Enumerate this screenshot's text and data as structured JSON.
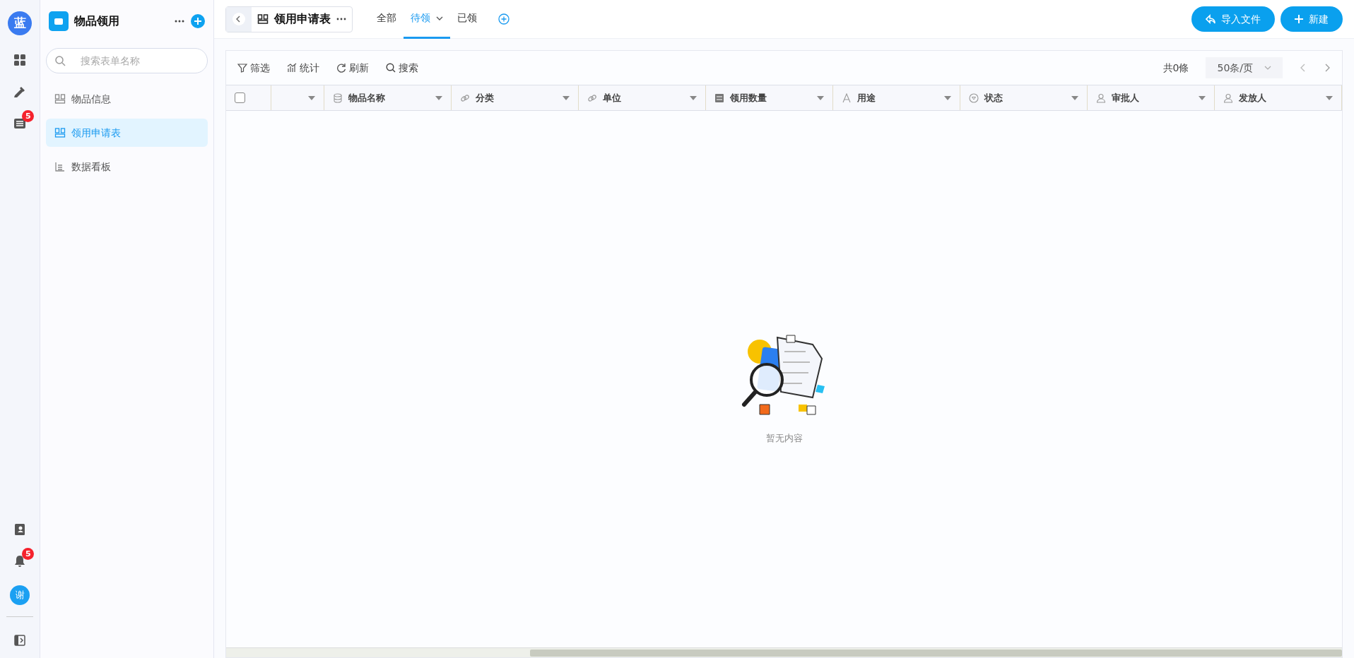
{
  "rail": {
    "logo": "蓝",
    "items": [
      {
        "kind": "apps"
      },
      {
        "kind": "tools"
      },
      {
        "kind": "table",
        "badge": "5"
      }
    ],
    "bottom_items": [
      {
        "kind": "contacts"
      },
      {
        "kind": "bell",
        "badge": "5"
      }
    ],
    "avatar": "谢"
  },
  "sidebar": {
    "app_title": "物品领用",
    "search": {
      "placeholder": "搜索表单名称"
    },
    "items": [
      {
        "label": "物品信息",
        "kind": "form",
        "selected": false
      },
      {
        "label": "领用申请表",
        "kind": "form",
        "selected": true
      },
      {
        "label": "数据看板",
        "kind": "dashboard",
        "selected": false
      }
    ]
  },
  "header": {
    "form_title": "领用申请表",
    "tabs": [
      {
        "label": "全部",
        "selected": false,
        "dropdown": false
      },
      {
        "label": "待领",
        "selected": true,
        "dropdown": true
      },
      {
        "label": "已领",
        "selected": false,
        "dropdown": false
      }
    ],
    "buttons": [
      {
        "label": "导入文件",
        "kind": "import"
      },
      {
        "label": "新建",
        "kind": "add"
      }
    ]
  },
  "toolbar": {
    "actions": [
      {
        "label": "筛选",
        "kind": "filter"
      },
      {
        "label": "统计",
        "kind": "chart"
      },
      {
        "label": "刷新",
        "kind": "refresh"
      },
      {
        "label": "搜索",
        "kind": "search"
      }
    ],
    "total": "共0條",
    "page_size": "50条/页"
  },
  "table": {
    "select_all_checked": false,
    "columns": [
      {
        "kind": "blank"
      },
      {
        "label": "物品名称",
        "kind": "database"
      },
      {
        "label": "分类",
        "kind": "link"
      },
      {
        "label": "单位",
        "kind": "link"
      },
      {
        "label": "领用数量",
        "kind": "number"
      },
      {
        "label": "用途",
        "kind": "text"
      },
      {
        "label": "状态",
        "kind": "status"
      },
      {
        "label": "审批人",
        "kind": "person"
      },
      {
        "label": "发放人",
        "kind": "person"
      }
    ]
  },
  "empty_state": {
    "text": "暂无内容"
  }
}
